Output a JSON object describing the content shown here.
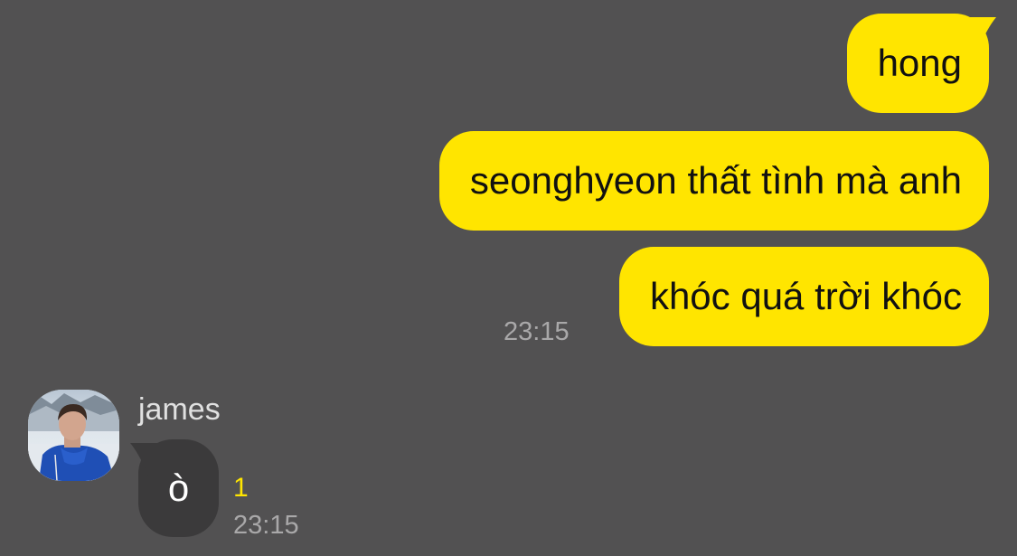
{
  "colors": {
    "background": "#525152",
    "outgoing_bubble": "#ffe500",
    "incoming_bubble": "#3b3a3b",
    "unread_count": "#ffe500",
    "timestamp": "#a9a8a9"
  },
  "outgoing_messages": [
    {
      "text": "hong"
    },
    {
      "text": "seonghyeon thất tình mà anh"
    },
    {
      "text": "khóc quá trời khóc"
    }
  ],
  "outgoing_time": "23:15",
  "incoming": {
    "sender_name": "james",
    "avatar_icon": "profile-photo",
    "message": "ò",
    "unread_count": "1",
    "time": "23:15"
  }
}
